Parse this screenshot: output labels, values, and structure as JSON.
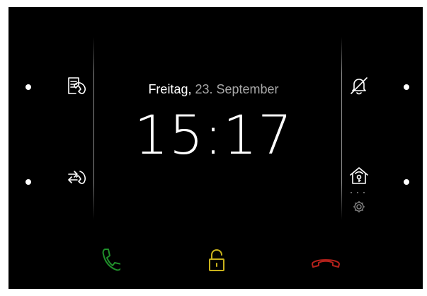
{
  "date": {
    "weekday": "Freitag,",
    "rest": " 23. September"
  },
  "clock": {
    "time": "15:17"
  },
  "left_panel": {
    "icons": [
      "call-log-icon",
      "call-forward-icon"
    ]
  },
  "right_panel": {
    "icons": [
      "bell-muted-icon",
      "home-key-icon",
      "settings-icon"
    ]
  },
  "bottom_bar": {
    "icons": [
      "accept-call-icon",
      "unlock-door-icon",
      "end-call-icon"
    ]
  },
  "colors": {
    "accept": "#1f8f2a",
    "unlock": "#c9b21c",
    "end_call": "#b3211b"
  }
}
